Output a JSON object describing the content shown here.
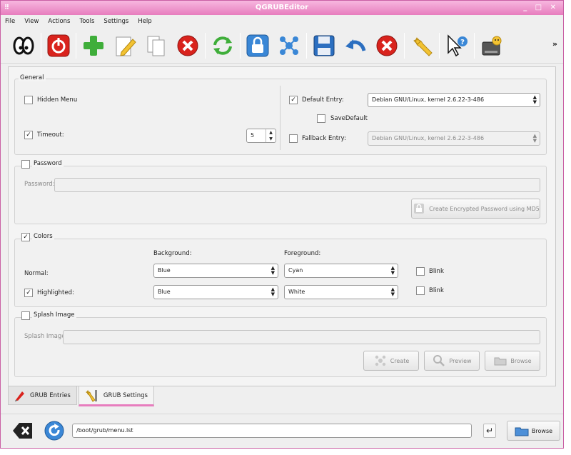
{
  "window": {
    "title": "QGRUBEditor",
    "sys": "⠿",
    "controls": "_ □ ✕"
  },
  "menu": [
    "File",
    "View",
    "Actions",
    "Tools",
    "Settings",
    "Help"
  ],
  "toolbar": {
    "more": "»",
    "icons": [
      "eyes-icon",
      "power-icon",
      "add-icon",
      "edit-icon",
      "copy-icon",
      "delete-icon",
      "refresh-icon",
      "lock-icon",
      "molecule-icon",
      "save-icon",
      "undo-icon",
      "cancel-icon",
      "wrench-icon",
      "help-pointer-icon",
      "disk-icon"
    ]
  },
  "general": {
    "label": "General",
    "hidden_menu": {
      "label": "Hidden Menu",
      "checked": false
    },
    "timeout": {
      "label": "Timeout:",
      "checked": true,
      "value": "5"
    },
    "default_entry": {
      "label": "Default Entry:",
      "checked": true,
      "value": "Debian GNU/Linux, kernel 2.6.22-3-486"
    },
    "save_default": {
      "label": "SaveDefault",
      "checked": false
    },
    "fallback_entry": {
      "label": "Fallback Entry:",
      "checked": false,
      "value": "Debian GNU/Linux, kernel 2.6.22-3-486"
    }
  },
  "password": {
    "label": "Password",
    "checked": false,
    "field_label": "Password:",
    "field_value": "",
    "create_button": "Create Encrypted Password using MD5"
  },
  "colors": {
    "label": "Colors",
    "checked": true,
    "background_header": "Background:",
    "foreground_header": "Foreground:",
    "normal_label": "Normal:",
    "normal_bg": "Blue",
    "normal_fg": "Cyan",
    "normal_blink": "Blink",
    "highlighted_label": "Highlighted:",
    "highlighted_checked": true,
    "highlighted_bg": "Blue",
    "highlighted_fg": "White",
    "highlighted_blink": "Blink"
  },
  "splash": {
    "label": "Splash Image",
    "checked": false,
    "field_label": "Splash Image:",
    "field_value": "",
    "create": "Create",
    "preview": "Preview",
    "browse": "Browse"
  },
  "tabs": [
    "GRUB Entries",
    "GRUB Settings"
  ],
  "bottom": {
    "path": "/boot/grub/menu.lst",
    "browse": "Browse"
  }
}
